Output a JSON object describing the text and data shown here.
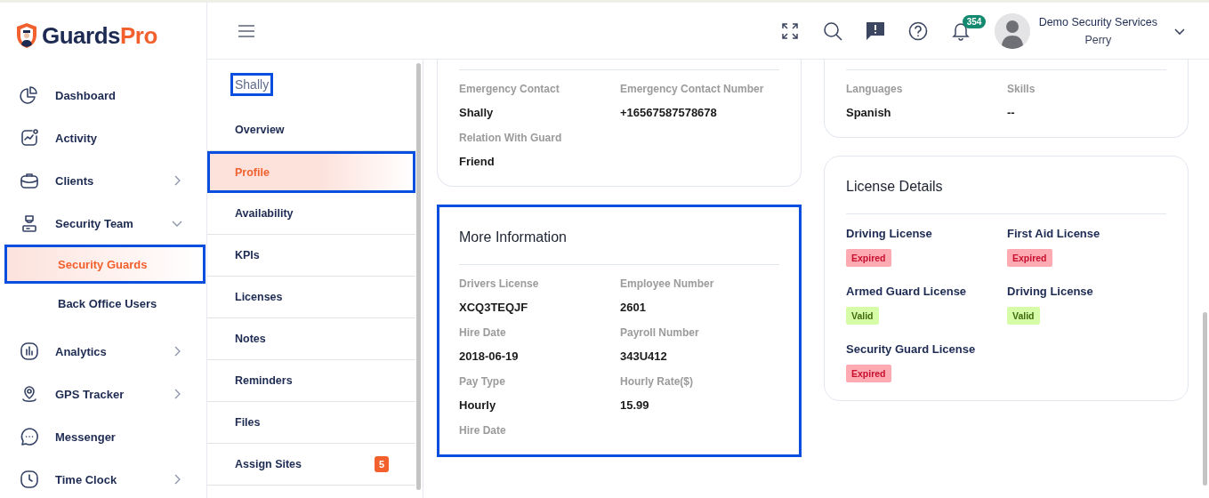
{
  "logo": {
    "text_dark": "Guards",
    "text_accent": "Pro"
  },
  "sidebar": {
    "items": [
      {
        "label": "Dashboard",
        "selected": false
      },
      {
        "label": "Activity",
        "selected": false
      },
      {
        "label": "Clients",
        "selected": false,
        "expanded": false
      },
      {
        "label": "Security Team",
        "selected": false,
        "expanded": true,
        "children": [
          {
            "label": "Security Guards",
            "selected": true,
            "highlighted": true
          },
          {
            "label": "Back Office Users",
            "selected": false,
            "highlighted": false
          }
        ]
      },
      {
        "label": "Analytics",
        "selected": false,
        "expanded": false
      },
      {
        "label": "GPS Tracker",
        "selected": false,
        "expanded": false
      },
      {
        "label": "Messenger",
        "selected": false
      },
      {
        "label": "Time Clock",
        "selected": false,
        "expanded": false
      }
    ]
  },
  "header": {
    "notification_count": "354",
    "user": {
      "company": "Demo Security Services",
      "name": "Perry"
    }
  },
  "subnav": {
    "title": "Shally",
    "title_highlighted": true,
    "items": [
      {
        "label": "Overview",
        "selected": false,
        "highlighted": false
      },
      {
        "label": "Profile",
        "selected": true,
        "highlighted": true
      },
      {
        "label": "Availability",
        "selected": false,
        "highlighted": false
      },
      {
        "label": "KPIs",
        "selected": false,
        "highlighted": false
      },
      {
        "label": "Licenses",
        "selected": false,
        "highlighted": false
      },
      {
        "label": "Notes",
        "selected": false,
        "highlighted": false
      },
      {
        "label": "Reminders",
        "selected": false,
        "highlighted": false
      },
      {
        "label": "Files",
        "selected": false,
        "highlighted": false
      },
      {
        "label": "Assign Sites",
        "selected": false,
        "highlighted": false,
        "badge": "5"
      }
    ]
  },
  "middle_column": [
    {
      "highlighted": false,
      "fields": [
        {
          "label": "Emergency Contact",
          "value": "Shally"
        },
        {
          "label": "Emergency Contact Number",
          "value": "+16567587578678"
        },
        {
          "label": "Relation With Guard",
          "value": "Friend"
        }
      ]
    },
    {
      "title": "More Information",
      "highlighted": true,
      "fields": [
        {
          "label": "Drivers License",
          "value": "XCQ3TEQJF"
        },
        {
          "label": "Employee Number",
          "value": "2601"
        },
        {
          "label": "Hire Date",
          "value": "2018-06-19"
        },
        {
          "label": "Payroll Number",
          "value": "343U412"
        },
        {
          "label": "Pay Type",
          "value": "Hourly"
        },
        {
          "label": "Hourly Rate($)",
          "value": "15.99"
        },
        {
          "label": "Hire Date"
        }
      ]
    }
  ],
  "right_column": [
    {
      "highlighted": false,
      "fields": [
        {
          "label": "Languages",
          "value": "Spanish"
        },
        {
          "label": "Skills",
          "value": "--"
        }
      ]
    },
    {
      "title": "License Details",
      "highlighted": false,
      "licenses": [
        {
          "name": "Driving License",
          "status": "Expired",
          "kind": "expired"
        },
        {
          "name": "First Aid License",
          "status": "Expired",
          "kind": "expired"
        },
        {
          "name": "Armed Guard License",
          "status": "Valid",
          "kind": "valid"
        },
        {
          "name": "Driving License",
          "status": "Valid",
          "kind": "valid"
        },
        {
          "name": "Security Guard License",
          "status": "Expired",
          "kind": "expired"
        }
      ]
    }
  ]
}
